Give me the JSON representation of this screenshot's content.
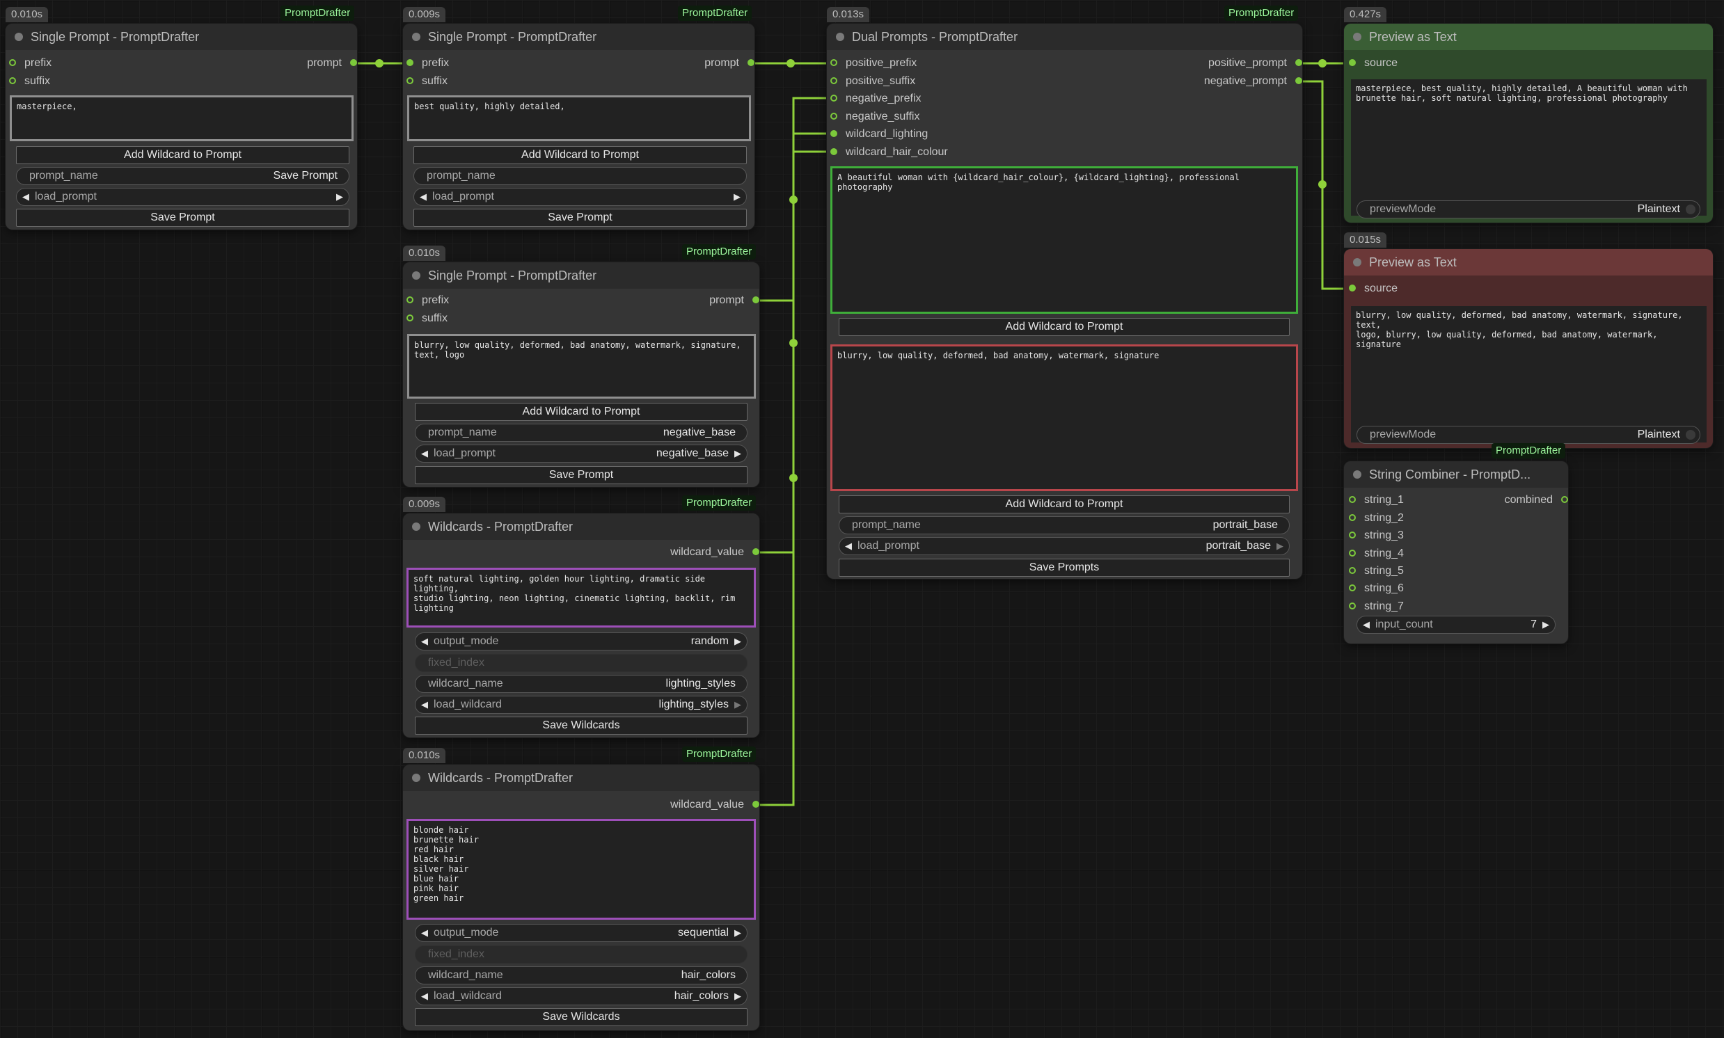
{
  "pack": "PromptDrafter",
  "common": {
    "add_wildcard": "Add Wildcard to Prompt",
    "save_prompt": "Save Prompt",
    "save_prompts": "Save Prompts",
    "save_wildcards": "Save Wildcards",
    "prompt_name_label": "prompt_name",
    "load_prompt_label": "load_prompt",
    "output_mode_label": "output_mode",
    "fixed_index_label": "fixed_index",
    "wildcard_name_label": "wildcard_name",
    "load_wildcard_label": "load_wildcard",
    "preview_mode_label": "previewMode",
    "input_count_label": "input_count",
    "prefix": "prefix",
    "suffix": "suffix",
    "prompt": "prompt",
    "source": "source",
    "wildcard_value": "wildcard_value"
  },
  "single1": {
    "time": "0.010s",
    "title": "Single Prompt - PromptDrafter",
    "text": "masterpiece,",
    "prompt_name_value": "Save Prompt",
    "load_prompt_value": ""
  },
  "single2": {
    "time": "0.009s",
    "title": "Single Prompt - PromptDrafter",
    "text": "best quality, highly detailed,",
    "prompt_name_value": "",
    "load_prompt_value": ""
  },
  "single3": {
    "time": "0.010s",
    "title": "Single Prompt - PromptDrafter",
    "text": "blurry, low quality, deformed, bad anatomy, watermark, signature,\ntext, logo",
    "prompt_name_value": "negative_base",
    "load_prompt_value": "negative_base"
  },
  "wild1": {
    "time": "0.009s",
    "title": "Wildcards - PromptDrafter",
    "text": "soft natural lighting, golden hour lighting, dramatic side lighting,\nstudio lighting, neon lighting, cinematic lighting, backlit, rim\nlighting",
    "output_mode_value": "random",
    "wildcard_name_value": "lighting_styles",
    "load_wildcard_value": "lighting_styles"
  },
  "wild2": {
    "time": "0.010s",
    "title": "Wildcards - PromptDrafter",
    "text": "blonde hair\nbrunette hair\nred hair\nblack hair\nsilver hair\nblue hair\npink hair\ngreen hair",
    "output_mode_value": "sequential",
    "wildcard_name_value": "hair_colors",
    "load_wildcard_value": "hair_colors"
  },
  "dual": {
    "time": "0.013s",
    "title": "Dual Prompts - PromptDrafter",
    "inputs": [
      "positive_prefix",
      "positive_suffix",
      "negative_prefix",
      "negative_suffix",
      "wildcard_lighting",
      "wildcard_hair_colour"
    ],
    "outputs": [
      "positive_prompt",
      "negative_prompt"
    ],
    "positive_text": "A beautiful woman with {wildcard_hair_colour}, {wildcard_lighting}, professional photography",
    "negative_text": "blurry, low quality, deformed, bad anatomy, watermark, signature",
    "prompt_name_value": "portrait_base",
    "load_prompt_value": "portrait_base"
  },
  "preview1": {
    "time": "0.427s",
    "title": "Preview as Text",
    "text": "masterpiece, best quality, highly detailed, A beautiful woman with\nbrunette hair, soft natural lighting, professional photography",
    "preview_mode_value": "Plaintext"
  },
  "preview2": {
    "time": "0.015s",
    "title": "Preview as Text",
    "text": "blurry, low quality, deformed, bad anatomy, watermark, signature, text,\nlogo, blurry, low quality, deformed, bad anatomy, watermark, signature",
    "preview_mode_value": "Plaintext"
  },
  "combiner": {
    "title": "String Combiner - PromptD...",
    "inputs": [
      "string_1",
      "string_2",
      "string_3",
      "string_4",
      "string_5",
      "string_6",
      "string_7"
    ],
    "output": "combined",
    "input_count_value": "7"
  },
  "colors": {
    "wire": "#8fd13a",
    "green_border": "#3fae3a",
    "red_border": "#b8464b",
    "purple_border": "#9d4fb8"
  }
}
